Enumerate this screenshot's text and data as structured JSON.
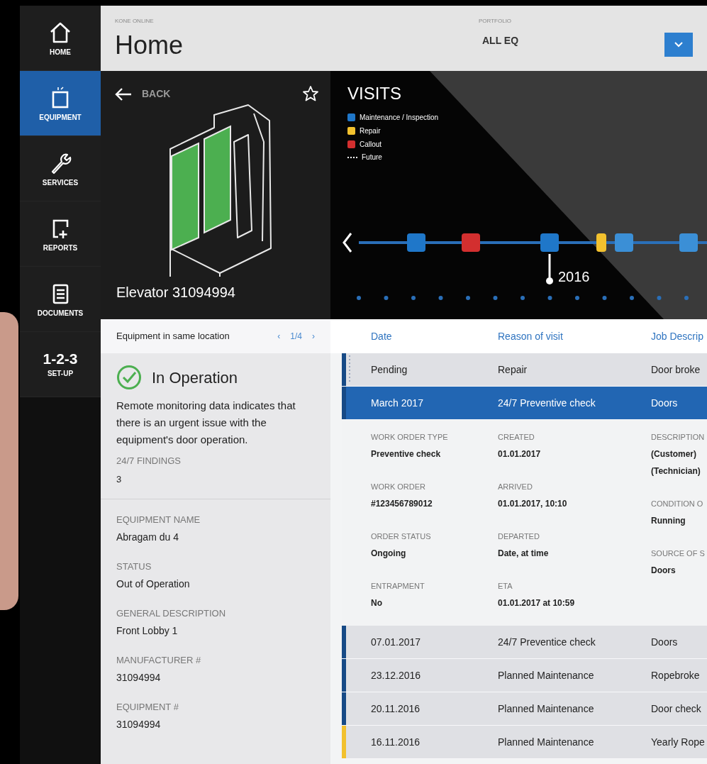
{
  "sidebar": {
    "items": [
      {
        "kind": "home",
        "label": "HOME",
        "selected": false
      },
      {
        "kind": "equipment",
        "label": "EQUIPMENT",
        "selected": true
      },
      {
        "kind": "services",
        "label": "SERVICES",
        "selected": false
      },
      {
        "kind": "reports",
        "label": "REPORTS",
        "selected": false
      },
      {
        "kind": "documents",
        "label": "DOCUMENTS",
        "selected": false
      },
      {
        "kind": "setup",
        "glyph": "1-2-3",
        "label": "SET-UP",
        "selected": false
      }
    ]
  },
  "header": {
    "app_name": "KONE ONLINE",
    "title": "Home",
    "portfolio_label": "PORTFOLIO",
    "portfolio_value": "ALL EQ"
  },
  "equipment": {
    "back": "BACK",
    "name": "Elevator 31094994"
  },
  "visits": {
    "title": "VISITS",
    "legend": [
      {
        "kind": "swatch",
        "label": "Maintenance / Inspection",
        "color": "#1f77c9"
      },
      {
        "kind": "swatch",
        "label": "Repair",
        "color": "#f2c12e"
      },
      {
        "kind": "swatch",
        "label": "Callout",
        "color": "#d32f2f"
      },
      {
        "kind": "dashes",
        "label": "Future"
      }
    ],
    "markers": [
      {
        "color": "#1f77c9"
      },
      {
        "color": "#d32f2f"
      },
      {
        "color": "#1f77c9"
      },
      {
        "color": "#f2c12e"
      },
      {
        "color": "#3b8fd6"
      },
      {
        "color": "#3b8fd6"
      }
    ],
    "year": "2016"
  },
  "location": {
    "title": "Equipment in same location",
    "page": "1/4",
    "prev": "‹",
    "next": "›"
  },
  "status": {
    "title": "In Operation",
    "message": "Remote monitoring data indicates that there is an urgent issue with the equipment's door operation.",
    "findings_label": "24/7 FINDINGS",
    "findings_value": "3"
  },
  "fields": [
    {
      "label": "EQUIPMENT NAME",
      "value": "Abragam du 4"
    },
    {
      "label": "STATUS",
      "value": "Out of Operation"
    },
    {
      "label": "GENERAL DESCRIPTION",
      "value": "Front Lobby 1"
    },
    {
      "label": "MANUFACTURER #",
      "value": "31094994"
    },
    {
      "label": "EQUIPMENT #",
      "value": "31094994"
    }
  ],
  "table": {
    "columns": [
      "Date",
      "Reason of visit",
      "Job Descrip"
    ],
    "rows": [
      {
        "cells": [
          "Pending",
          "Repair",
          "Door broke"
        ],
        "color": "#174a86",
        "future": true,
        "selected": false
      },
      {
        "cells": [
          "March 2017",
          "24/7 Preventive check",
          "Doors"
        ],
        "color": "#174a86",
        "future": false,
        "selected": true,
        "details": [
          [
            {
              "label": "WORK ORDER TYPE",
              "values": [
                "Preventive check"
              ]
            },
            {
              "label": "WORK ORDER",
              "values": [
                "#123456789012"
              ]
            },
            {
              "label": "ORDER STATUS",
              "values": [
                "Ongoing"
              ]
            },
            {
              "label": "ENTRAPMENT",
              "values": [
                "No"
              ]
            }
          ],
          [
            {
              "label": "CREATED",
              "values": [
                "01.01.2017"
              ]
            },
            {
              "label": "ARRIVED",
              "values": [
                "01.01.2017, 10:10"
              ]
            },
            {
              "label": "DEPARTED",
              "values": [
                "Date, at time"
              ]
            },
            {
              "label": "ETA",
              "values": [
                "01.01.2017 at 10:59"
              ]
            }
          ],
          [
            {
              "label": "DESCRIPTION",
              "values": [
                "(Customer)",
                "(Technician)"
              ]
            },
            {
              "label": "CONDITION O",
              "values": [
                "Running"
              ]
            },
            {
              "label": "SOURCE OF S",
              "values": [
                "Doors"
              ]
            }
          ]
        ]
      },
      {
        "cells": [
          "07.01.2017",
          "24/7 Preventice check",
          "Doors"
        ],
        "color": "#174a86",
        "future": false,
        "selected": false
      },
      {
        "cells": [
          "23.12.2016",
          "Planned Maintenance",
          "Ropebroke"
        ],
        "color": "#174a86",
        "future": false,
        "selected": false
      },
      {
        "cells": [
          "20.11.2016",
          "Planned Maintenance",
          "Door check"
        ],
        "color": "#174a86",
        "future": false,
        "selected": false
      },
      {
        "cells": [
          "16.11.2016",
          "Planned Maintenance",
          "Yearly Rope"
        ],
        "color": "#f2c12e",
        "future": false,
        "selected": false
      }
    ]
  }
}
